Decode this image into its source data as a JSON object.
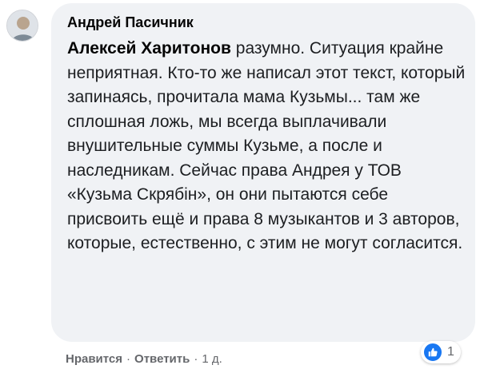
{
  "comment": {
    "author": "Андрей Пасичник",
    "mention": "Алексей Харитонов",
    "text": " разумно. Ситуация крайне неприятная. Кто-то же написал этот текст, который запинаясь, прочитала мама Кузьмы... там же сплошная ложь, мы всегда выплачивали внушительные суммы Кузьме, а после и наследникам. Сейчас права Андрея у ТОВ «Кузьма Скрябін», он они пытаются себе присвоить ещё и права 8 музыкантов и 3 авторов, которые, естественно, с этим не могут согласится.",
    "reactions": {
      "icon": "like-icon",
      "count": "1",
      "color": "#1877f2"
    }
  },
  "actions": {
    "like_label": "Нравится",
    "reply_label": "Ответить",
    "separator": "·",
    "timestamp": "1 д."
  },
  "colors": {
    "bubble_background": "#f0f2f5",
    "secondary_text": "#65676b"
  }
}
